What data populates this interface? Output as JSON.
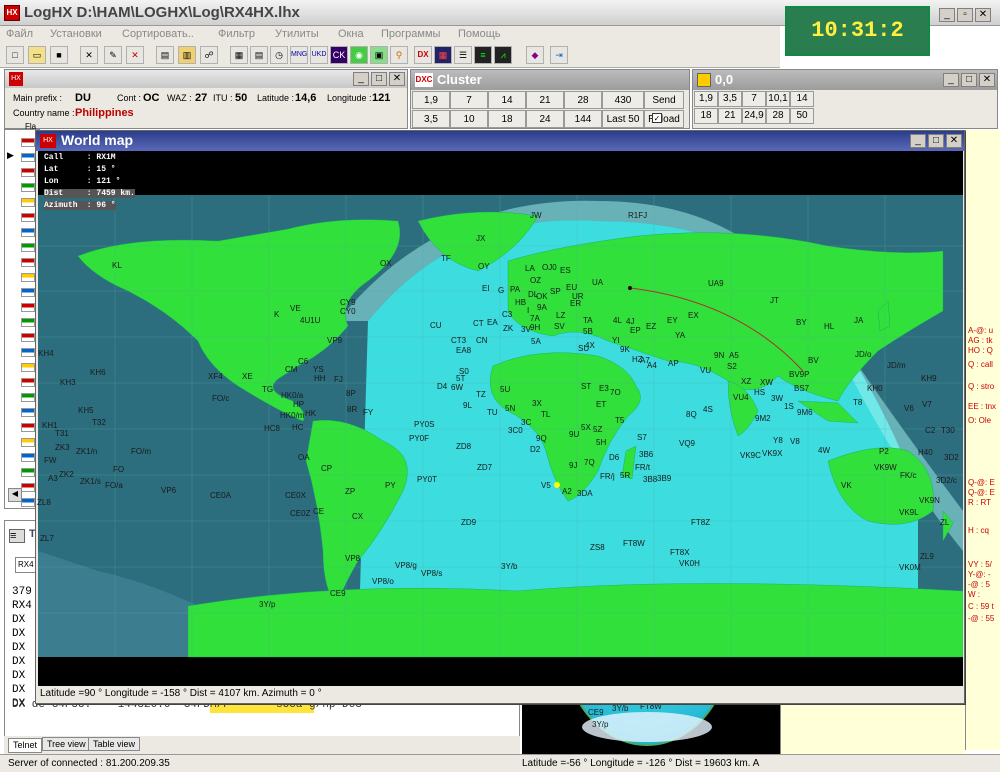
{
  "app": {
    "title": "LogHX  D:\\HAM\\LOGHX\\Log\\RX4HX.lhx",
    "clock": "10:31:2"
  },
  "menu": [
    "Файл",
    "Установки",
    "Сортировать..",
    "Фильтр",
    "Утилиты",
    "Окна",
    "Программы",
    "Помощь"
  ],
  "main_panel": {
    "prefix_label": "Main prefix :",
    "prefix": "DU",
    "cont_label": "Cont :",
    "cont": "OC",
    "waz_label": "WAZ :",
    "waz": "27",
    "itu_label": "ITU :",
    "itu": "50",
    "lat_label": "Latitude :",
    "lat": "14,6",
    "lon_label": "Longitude :",
    "lon": "121",
    "country_label": "Country name :",
    "country": "Philippines",
    "col_flag": "Fla"
  },
  "cluster": {
    "title": "Cluster",
    "row1": [
      "1,9",
      "7",
      "14",
      "21",
      "28",
      "430",
      "Send"
    ],
    "row2": [
      "3,5",
      "10",
      "18",
      "24",
      "144",
      "Last 50",
      "Reload"
    ]
  },
  "filter_panel": {
    "title": "0,0",
    "row1": [
      "1,9",
      "3,5",
      "7",
      "10,1",
      "14"
    ],
    "row2": [
      "18",
      "21",
      "24,9",
      "28",
      "50"
    ]
  },
  "worldmap": {
    "title": "World map",
    "info": [
      {
        "k": "Call",
        "v": "RX1M"
      },
      {
        "k": "Lat",
        "v": "15 °"
      },
      {
        "k": "Lon",
        "v": "121 °"
      },
      {
        "k": "Dist",
        "v": "7459 km."
      },
      {
        "k": "Azimuth",
        "v": "96 °"
      }
    ],
    "status": "Latitude =90 ° Longitude = -158 ° Dist = 4107 km. Azimuth = 0 °"
  },
  "dx_lines": [
    "379",
    "RX4",
    "DX",
    "DX",
    "DX",
    "DX",
    "DX",
    "DX",
    "DX",
    "DX de G4FUU:    144320.0  G4FDM/P       soca g/hp-D63"
  ],
  "bottom": {
    "tabs": [
      "Telnet",
      "Tree view",
      "Table view"
    ],
    "server": "Server of connected : 81.200.209.35",
    "globe_status": "Latitude =-56 ° Longitude = -126 ° Dist = 19603 km. A",
    "globe_labels": [
      "CE9",
      "3Y/b",
      "FT8W",
      "3Y/p"
    ]
  },
  "right_log": [
    "A-@: u",
    "AG : tk",
    "HO : Q",
    "Q : call",
    "Q : stro",
    "EE : tnx",
    "O: Ole",
    "Q-@: E",
    "Q-@: E",
    "R : RT",
    "H : cq",
    "VY : 5/",
    "Y-@: -",
    "-@ : 5",
    "W :",
    "C : 59 t",
    "-@ : 55"
  ],
  "side_labels": [
    "RX4",
    "TR"
  ],
  "prefixes": [
    [
      "JW",
      530,
      215
    ],
    [
      "R1FJ",
      628,
      215
    ],
    [
      "JX",
      476,
      238
    ],
    [
      "TF",
      441,
      258
    ],
    [
      "OX",
      380,
      263
    ],
    [
      "KL",
      112,
      265
    ],
    [
      "OY",
      478,
      266
    ],
    [
      "LA",
      525,
      268
    ],
    [
      "OJ0",
      542,
      267
    ],
    [
      "ES",
      560,
      270
    ],
    [
      "UA9",
      708,
      283
    ],
    [
      "OZ",
      530,
      280
    ],
    [
      "UA",
      592,
      282
    ],
    [
      "EI",
      482,
      288
    ],
    [
      "G",
      498,
      290
    ],
    [
      "PA",
      510,
      289
    ],
    [
      "DL",
      528,
      294
    ],
    [
      "SP",
      550,
      291
    ],
    [
      "EU",
      566,
      287
    ],
    [
      "UR",
      572,
      296
    ],
    [
      "HB",
      515,
      302
    ],
    [
      "OK",
      536,
      296
    ],
    [
      "ER",
      570,
      303
    ],
    [
      "JT",
      770,
      300
    ],
    [
      "CY9",
      340,
      302
    ],
    [
      "CY0",
      340,
      311
    ],
    [
      "K",
      274,
      314
    ],
    [
      "VE",
      290,
      308
    ],
    [
      "4U1U",
      300,
      320
    ],
    [
      "I",
      527,
      310
    ],
    [
      "9A",
      537,
      307
    ],
    [
      "EX",
      688,
      315
    ],
    [
      "CU",
      430,
      325
    ],
    [
      "CT",
      473,
      323
    ],
    [
      "EA",
      487,
      322
    ],
    [
      "C3",
      502,
      314
    ],
    [
      "7A",
      530,
      318
    ],
    [
      "LZ",
      556,
      315
    ],
    [
      "TA",
      583,
      320
    ],
    [
      "4L",
      613,
      320
    ],
    [
      "4J",
      626,
      321
    ],
    [
      "EY",
      667,
      320
    ],
    [
      "EP",
      630,
      330
    ],
    [
      "EZ",
      646,
      326
    ],
    [
      "YA",
      675,
      335
    ],
    [
      "BY",
      796,
      322
    ],
    [
      "HL",
      824,
      326
    ],
    [
      "JA",
      854,
      320
    ],
    [
      "CT3",
      451,
      340
    ],
    [
      "CN",
      476,
      340
    ],
    [
      "ZK",
      503,
      328
    ],
    [
      "3V",
      521,
      329
    ],
    [
      "9H",
      530,
      327
    ],
    [
      "SV",
      554,
      326
    ],
    [
      "5B",
      583,
      331
    ],
    [
      "4X",
      585,
      345
    ],
    [
      "YI",
      612,
      340
    ],
    [
      "VP9",
      327,
      340
    ],
    [
      "JD/o",
      855,
      354
    ],
    [
      "KH4",
      38,
      353
    ],
    [
      "KH6",
      90,
      372
    ],
    [
      "EA8",
      456,
      350
    ],
    [
      "5A",
      531,
      341
    ],
    [
      "SU",
      578,
      348
    ],
    [
      "9K",
      620,
      349
    ],
    [
      "HZ",
      632,
      359
    ],
    [
      "A7",
      640,
      360
    ],
    [
      "A4",
      647,
      365
    ],
    [
      "AP",
      668,
      363
    ],
    [
      "9N",
      714,
      355
    ],
    [
      "A5",
      729,
      355
    ],
    [
      "S2",
      727,
      366
    ],
    [
      "BV",
      808,
      360
    ],
    [
      "JD/m",
      887,
      365
    ],
    [
      "C6",
      298,
      361
    ],
    [
      "CM",
      285,
      369
    ],
    [
      "YS",
      313,
      369
    ],
    [
      "KH3",
      60,
      382
    ],
    [
      "XF4",
      208,
      376
    ],
    [
      "XE",
      242,
      376
    ],
    [
      "HH",
      314,
      378
    ],
    [
      "FJ",
      334,
      379
    ],
    [
      "S0",
      459,
      371
    ],
    [
      "5T",
      456,
      378
    ],
    [
      "XZ",
      741,
      381
    ],
    [
      "XW",
      760,
      382
    ],
    [
      "VU",
      700,
      370
    ],
    [
      "E3",
      599,
      388
    ],
    [
      "7O",
      610,
      392
    ],
    [
      "KH0",
      867,
      388
    ],
    [
      "KH9",
      921,
      378
    ],
    [
      "FO/c",
      212,
      398
    ],
    [
      "TG",
      262,
      389
    ],
    [
      "HK0/a",
      281,
      395
    ],
    [
      "8P",
      346,
      393
    ],
    [
      "D4",
      437,
      386
    ],
    [
      "6W",
      451,
      387
    ],
    [
      "TZ",
      476,
      394
    ],
    [
      "5U",
      500,
      389
    ],
    [
      "ST",
      581,
      386
    ],
    [
      "VU4",
      733,
      397
    ],
    [
      "HS",
      754,
      392
    ],
    [
      "3W",
      771,
      398
    ],
    [
      "9M6",
      797,
      412
    ],
    [
      "V7",
      922,
      404
    ],
    [
      "KH5",
      78,
      410
    ],
    [
      "HP",
      293,
      404
    ],
    [
      "HK0/m",
      280,
      415
    ],
    [
      "HK",
      305,
      413
    ],
    [
      "8R",
      347,
      409
    ],
    [
      "FY",
      363,
      412
    ],
    [
      "9L",
      463,
      405
    ],
    [
      "5N",
      505,
      408
    ],
    [
      "3X",
      532,
      403
    ],
    [
      "TL",
      541,
      414
    ],
    [
      "ET",
      596,
      404
    ],
    [
      "8Q",
      686,
      414
    ],
    [
      "4S",
      703,
      409
    ],
    [
      "9M2",
      755,
      418
    ],
    [
      "1S",
      784,
      406
    ],
    [
      "V6",
      904,
      408
    ],
    [
      "T8",
      853,
      402
    ],
    [
      "KH1",
      42,
      425
    ],
    [
      "T32",
      92,
      422
    ],
    [
      "HC8",
      264,
      428
    ],
    [
      "HC",
      292,
      427
    ],
    [
      "PY0S",
      414,
      424
    ],
    [
      "TU",
      487,
      412
    ],
    [
      "3C0",
      508,
      430
    ],
    [
      "3C",
      521,
      422
    ],
    [
      "T5",
      615,
      420
    ],
    [
      "5X",
      581,
      427
    ],
    [
      "5Z",
      593,
      429
    ],
    [
      "C2",
      925,
      430
    ],
    [
      "T30",
      941,
      430
    ],
    [
      "T31",
      55,
      433
    ],
    [
      "PY0F",
      409,
      438
    ],
    [
      "9Q",
      536,
      438
    ],
    [
      "9U",
      569,
      434
    ],
    [
      "5H",
      596,
      442
    ],
    [
      "S7",
      637,
      437
    ],
    [
      "VQ9",
      679,
      443
    ],
    [
      "Y8",
      773,
      440
    ],
    [
      "V8",
      790,
      441
    ],
    [
      "ZK3",
      55,
      447
    ],
    [
      "ZK1/n",
      76,
      451
    ],
    [
      "FO/m",
      131,
      451
    ],
    [
      "ZD8",
      456,
      446
    ],
    [
      "D2",
      530,
      449
    ],
    [
      "D6",
      609,
      457
    ],
    [
      "3B6",
      639,
      454
    ],
    [
      "VK9C",
      740,
      455
    ],
    [
      "VK9X",
      762,
      453
    ],
    [
      "4W",
      818,
      450
    ],
    [
      "P2",
      879,
      451
    ],
    [
      "H40",
      918,
      452
    ],
    [
      "3D2",
      944,
      457
    ],
    [
      "FW",
      44,
      460
    ],
    [
      "OA",
      298,
      457
    ],
    [
      "FR/t",
      635,
      467
    ],
    [
      "3B9",
      657,
      478
    ],
    [
      "VK9W",
      874,
      467
    ],
    [
      "FK/c",
      900,
      475
    ],
    [
      "3D2/c",
      936,
      480
    ],
    [
      "A3",
      48,
      478
    ],
    [
      "ZK2",
      59,
      474
    ],
    [
      "FO",
      113,
      469
    ],
    [
      "ZK1/s",
      80,
      481
    ],
    [
      "FO/a",
      105,
      485
    ],
    [
      "CP",
      321,
      468
    ],
    [
      "ZD7",
      477,
      467
    ],
    [
      "PY0T",
      417,
      479
    ],
    [
      "9J",
      569,
      465
    ],
    [
      "7Q",
      584,
      462
    ],
    [
      "FR/j",
      600,
      476
    ],
    [
      "5R",
      620,
      475
    ],
    [
      "3B8",
      643,
      479
    ],
    [
      "VK",
      841,
      485
    ],
    [
      "ZL8",
      37,
      502
    ],
    [
      "VP6",
      161,
      490
    ],
    [
      "CE0A",
      210,
      495
    ],
    [
      "CE0X",
      285,
      495
    ],
    [
      "ZP",
      345,
      491
    ],
    [
      "PY",
      385,
      485
    ],
    [
      "V5",
      541,
      485
    ],
    [
      "A2",
      562,
      491
    ],
    [
      "3DA",
      577,
      493
    ],
    [
      "VK9N",
      919,
      500
    ],
    [
      "VK9L",
      899,
      512
    ],
    [
      "ZL",
      940,
      522
    ],
    [
      "CE0Z",
      290,
      513
    ],
    [
      "CE",
      313,
      511
    ],
    [
      "CX",
      352,
      516
    ],
    [
      "ZD9",
      461,
      522
    ],
    [
      "FT8Z",
      691,
      522
    ],
    [
      "ZL7",
      40,
      538
    ],
    [
      "ZS8",
      590,
      547
    ],
    [
      "FT8W",
      623,
      543
    ],
    [
      "FT8X",
      670,
      552
    ],
    [
      "VK0H",
      679,
      563
    ],
    [
      "ZL9",
      920,
      556
    ],
    [
      "VK0M",
      899,
      567
    ],
    [
      "VP8",
      345,
      558
    ],
    [
      "VP8/g",
      395,
      565
    ],
    [
      "VP8/s",
      421,
      573
    ],
    [
      "3Y/b",
      501,
      566
    ],
    [
      "VP8/o",
      372,
      581
    ],
    [
      "CE9",
      330,
      593
    ],
    [
      "3Y/p",
      259,
      604
    ],
    [
      "BS7",
      794,
      388
    ],
    [
      "BV9P",
      789,
      374
    ]
  ]
}
